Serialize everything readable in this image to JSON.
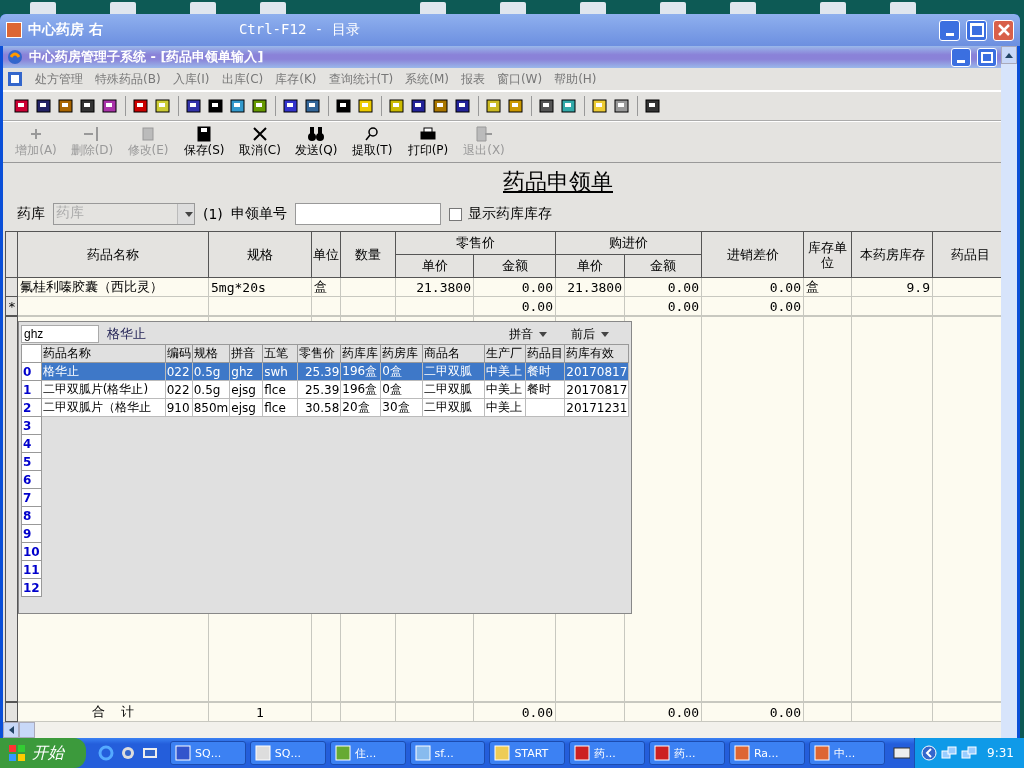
{
  "outer_window": {
    "title": "中心药房 右",
    "hint": "Ctrl-F12 - 目录"
  },
  "inner_window": {
    "title": "中心药房管理子系统 - [药品申领单输入]"
  },
  "menu": [
    "处方管理",
    "特殊药品(B)",
    "入库(I)",
    "出库(C)",
    "库存(K)",
    "查询统计(T)",
    "系统(M)",
    "报表",
    "窗口(W)",
    "帮助(H)"
  ],
  "actions": [
    {
      "label": "增加(A)",
      "disabled": true
    },
    {
      "label": "删除(D)",
      "disabled": true
    },
    {
      "label": "修改(E)",
      "disabled": true
    },
    {
      "label": "保存(S)",
      "disabled": false
    },
    {
      "label": "取消(C)",
      "disabled": false
    },
    {
      "label": "发送(Q)",
      "disabled": false
    },
    {
      "label": "提取(T)",
      "disabled": false
    },
    {
      "label": "打印(P)",
      "disabled": false
    },
    {
      "label": "退出(X)",
      "disabled": true
    }
  ],
  "form": {
    "title": "药品申领单",
    "store_label": "药库",
    "store_value": "药库",
    "store_count": "(1)",
    "order_label": "申领单号",
    "show_stock": {
      "label": "显示药库库存",
      "checked": false
    }
  },
  "table": {
    "columns": [
      {
        "label": "药品名称"
      },
      {
        "label": "规格"
      },
      {
        "label": "单位"
      },
      {
        "label": "数量"
      },
      {
        "group": "零售价",
        "colspan": 2,
        "subs": [
          "单价",
          "金额"
        ]
      },
      {
        "group": "购进价",
        "colspan": 2,
        "subs": [
          "单价",
          "金额"
        ]
      },
      {
        "label": "进销差价"
      },
      {
        "label": "库存单位"
      },
      {
        "label": "本药房库存"
      },
      {
        "label": "药品目"
      }
    ],
    "rows": [
      {
        "marker": null,
        "cells": [
          "氟桂利嗪胶囊（西比灵）",
          "5mg*20s",
          "盒",
          null,
          "21.3800",
          "0.00",
          "21.3800",
          "0.00",
          "0.00",
          "盒",
          "9.9",
          null
        ]
      },
      {
        "marker": "*",
        "cells": [
          null,
          null,
          null,
          null,
          null,
          "0.00",
          null,
          "0.00",
          "0.00",
          null,
          null,
          null
        ]
      }
    ],
    "totals": {
      "cells": [
        "合  计",
        "1",
        null,
        null,
        null,
        "0.00",
        null,
        "0.00",
        "0.00",
        null,
        null,
        null
      ]
    }
  },
  "popup": {
    "search_value": "ghz",
    "match": "格华止",
    "sort_1": "拼音",
    "sort_2": "前后",
    "columns": [
      "药品名称",
      "编码",
      "规格",
      "拼音",
      "五笔",
      "零售价",
      "药库库",
      "药房库",
      "商品名",
      "生产厂",
      "药品目",
      "药库有效"
    ],
    "rows": [
      {
        "index": "0",
        "selected": true,
        "cells": [
          "格华止",
          "022",
          "0.5g",
          "ghz",
          "swh",
          "25.39",
          "196盒",
          "0盒",
          "二甲双胍",
          "中美上",
          "餐时",
          "20170817"
        ]
      },
      {
        "index": "1",
        "selected": false,
        "cells": [
          "二甲双胍片(格华止)",
          "022",
          "0.5g",
          "ejsg",
          "flce",
          "25.39",
          "196盒",
          "0盒",
          "二甲双胍",
          "中美上",
          "餐时",
          "20170817"
        ]
      },
      {
        "index": "2",
        "selected": false,
        "cells": [
          "二甲双胍片（格华止",
          "910",
          "850m",
          "ejsg",
          "flce",
          "30.58",
          "20盒",
          "30盒",
          "二甲双胍",
          "中美上",
          null,
          "20171231"
        ]
      },
      {
        "index": "3"
      },
      {
        "index": "4"
      },
      {
        "index": "5"
      },
      {
        "index": "6"
      },
      {
        "index": "7"
      },
      {
        "index": "8"
      },
      {
        "index": "9"
      },
      {
        "index": "10"
      },
      {
        "index": "11"
      },
      {
        "index": "12"
      }
    ]
  },
  "taskbar": {
    "start": "开始",
    "tasks": [
      "SQ...",
      "SQ...",
      "住...",
      "sf...",
      "START",
      "药...",
      "药...",
      "Ra...",
      "中..."
    ],
    "clock": "9:31"
  }
}
